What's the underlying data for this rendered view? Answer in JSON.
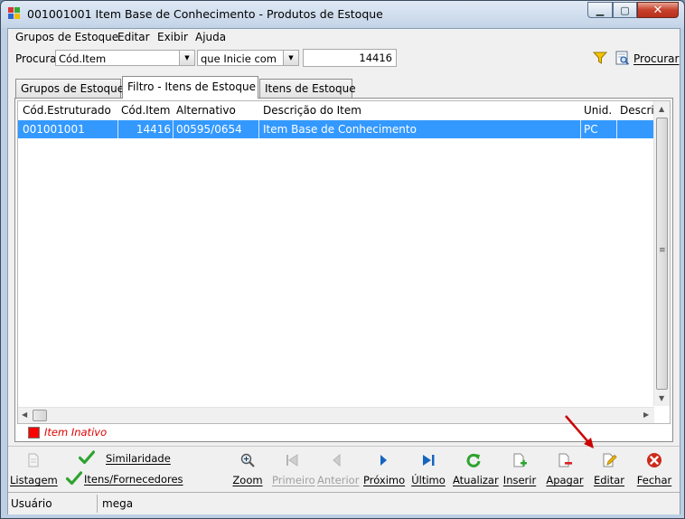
{
  "window": {
    "title": "001001001 Item Base de Conhecimento -  Produtos de Estoque",
    "minimize": "▁",
    "maximize": "▢",
    "close": "✕"
  },
  "menu": [
    "Grupos de Estoque",
    "Editar",
    "Exibir",
    "Ajuda"
  ],
  "search": {
    "label": "Procurar",
    "field": "Cód.Item",
    "operator": "que Inicie com",
    "value": "14416",
    "button": "Procurar"
  },
  "tabs": [
    "Grupos de Estoque",
    "Filtro - Itens de Estoque",
    "Itens de Estoque"
  ],
  "grid": {
    "columns": [
      "Cód.Estruturado",
      "Cód.Item",
      "Alternativo",
      "Descrição do Item",
      "Unid.",
      "Descriç"
    ],
    "rows": [
      [
        "001001001",
        "14416",
        "00595/0654",
        "Item Base de Conhecimento",
        "PC",
        ""
      ]
    ]
  },
  "legend": {
    "label": "Item Inativo",
    "color": "#ff0000"
  },
  "toolbar": {
    "listagem": "Listagem",
    "similaridade": "Similaridade",
    "itens_fornecedores": "Itens/Fornecedores",
    "zoom": "Zoom",
    "primeiro": "Primeiro",
    "anterior": "Anterior",
    "proximo": "Próximo",
    "ultimo": "Último",
    "atualizar": "Atualizar",
    "inserir": "Inserir",
    "apagar": "Apagar",
    "editar": "Editar",
    "fechar": "Fechar"
  },
  "status": {
    "label": "Usuário",
    "value": "mega"
  },
  "colors": {
    "selection": "#3399ff",
    "nav_blue": "#1565c0",
    "refresh_green": "#2fa32f",
    "close_red": "#cc2a1a",
    "arrow_red": "#cc0000"
  }
}
